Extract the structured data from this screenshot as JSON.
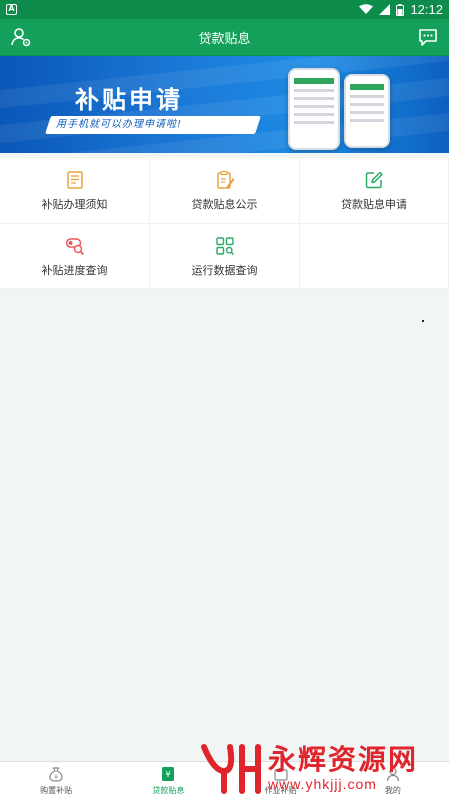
{
  "status_bar": {
    "time": "12:12",
    "notification_icon": "A"
  },
  "app_bar": {
    "title": "贷款贴息",
    "left_icon": "user-settings-icon",
    "right_icon": "message-icon"
  },
  "banner": {
    "headline": "补贴申请",
    "subline": "用手机就可以办理申请啦!"
  },
  "menu": {
    "items": [
      {
        "label": "补贴办理须知",
        "icon": "document-list-icon",
        "color": "#e8a33d"
      },
      {
        "label": "贷款贴息公示",
        "icon": "clipboard-edit-icon",
        "color": "#e8a33d"
      },
      {
        "label": "贷款贴息申请",
        "icon": "edit-square-icon",
        "color": "#2aa968"
      },
      {
        "label": "补贴进度查询",
        "icon": "progress-search-icon",
        "color": "#e85a5a"
      },
      {
        "label": "运行数据查询",
        "icon": "grid-search-icon",
        "color": "#2aa968"
      }
    ]
  },
  "tab_bar": {
    "tabs": [
      {
        "label": "购置补贴",
        "icon": "money-bag-icon",
        "active": false
      },
      {
        "label": "贷款贴息",
        "icon": "loan-icon",
        "active": true
      },
      {
        "label": "作业补贴",
        "icon": "work-icon",
        "active": false
      },
      {
        "label": "我的",
        "icon": "user-icon",
        "active": false
      }
    ]
  },
  "watermark": {
    "brand": "永辉资源网",
    "url": "www.yhkjjj.com"
  },
  "colors": {
    "primary": "#12a05a",
    "status_bar": "#0d8c4b",
    "watermark": "#e0242b"
  }
}
